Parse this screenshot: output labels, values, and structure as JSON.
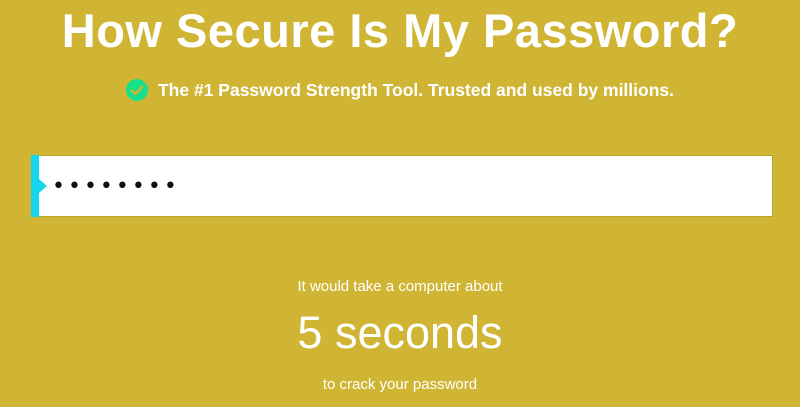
{
  "header": {
    "title": "How Secure Is My Password?",
    "tagline": "The #1 Password Strength Tool. Trusted and used by millions."
  },
  "password": {
    "value": "password",
    "placeholder": ""
  },
  "result": {
    "prefix": "It would take a computer about",
    "time": "5 seconds",
    "suffix": "to crack your password"
  },
  "icons": {
    "tagline_icon": "check-circle-icon"
  },
  "colors": {
    "background": "#cfb533",
    "check": "#16e08a",
    "accent": "#16d6ee",
    "text": "#ffffff"
  }
}
